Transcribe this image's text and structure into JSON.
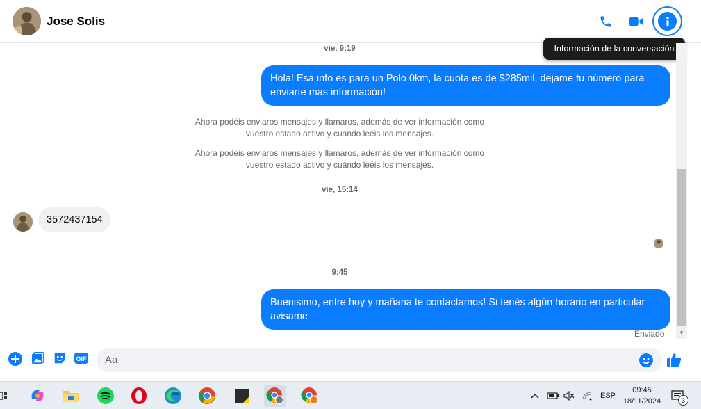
{
  "header": {
    "contact_name": "Jose Solis",
    "tooltip": "Información de la conversación"
  },
  "messages": {
    "time_1": "vie, 9:19",
    "out_1": "Hola! Esa info es para un Polo 0km, la cuota es de $285mil, dejame tu número para enviarte mas información!",
    "system_1": "Ahora podéis enviaros mensajes y llamaros, además de ver información como vuestro estado activo y cuándo leéis los mensajes.",
    "system_2": "Ahora podéis enviaros mensajes y llamaros, además de ver información como vuestro estado activo y cuándo leéis los mensajes.",
    "time_2": "vie, 15:14",
    "in_1": "3572437154",
    "time_3": "9:45",
    "out_2": "Buenisimo, entre hoy y mañana te contactamos! Si tenés algún horario en particular avisame",
    "status": "Enviado"
  },
  "composer": {
    "placeholder": "Aa",
    "icons": [
      "plus-icon",
      "image-icon",
      "sticker-icon",
      "gif-icon",
      "emoji-icon",
      "like-icon"
    ],
    "gif_label": "GIF"
  },
  "taskbar": {
    "language": "ESP",
    "time": "09:45",
    "date": "18/11/2024",
    "notifications": "3",
    "apps": [
      "widgets-icon",
      "copilot-icon",
      "file-explorer-icon",
      "spotify-icon",
      "opera-icon",
      "edge-icon",
      "chrome-icon",
      "sticky-notes-icon",
      "chrome-profile-icon",
      "chrome-profile-2-icon"
    ]
  },
  "colors": {
    "accent": "#0a7cff",
    "incoming_bubble": "#f0f0f0",
    "meta_text": "#65676b"
  }
}
